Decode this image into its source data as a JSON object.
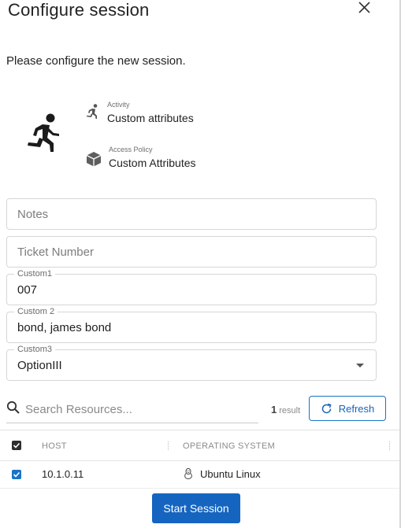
{
  "dialog": {
    "title": "Configure session",
    "intro": "Please configure the new session."
  },
  "summary": {
    "activity_caption": "Activity",
    "activity_value": "Custom attributes",
    "policy_caption": "Access Policy",
    "policy_value": "Custom Attributes",
    "icons": [
      "running-person-icon",
      "cube-icon"
    ]
  },
  "form": {
    "notes_placeholder": "Notes",
    "ticket_placeholder": "Ticket Number",
    "custom1_label": "Custom1",
    "custom1_value": "007",
    "custom2_label": "Custom 2",
    "custom2_value": "bond, james bond",
    "custom3_label": "Custom3",
    "custom3_value": "OptionIII"
  },
  "resources": {
    "search_placeholder": "Search Resources...",
    "result_count": "1",
    "result_word": "result",
    "refresh_label": "Refresh",
    "columns": [
      "HOST",
      "OPERATING SYSTEM"
    ],
    "rows": [
      {
        "host": "10.1.0.11",
        "os": "Ubuntu Linux",
        "checked": true
      }
    ]
  },
  "actions": {
    "start_label": "Start Session"
  },
  "colors": {
    "accent": "#1a73c8",
    "primary_button": "#1565c0"
  }
}
